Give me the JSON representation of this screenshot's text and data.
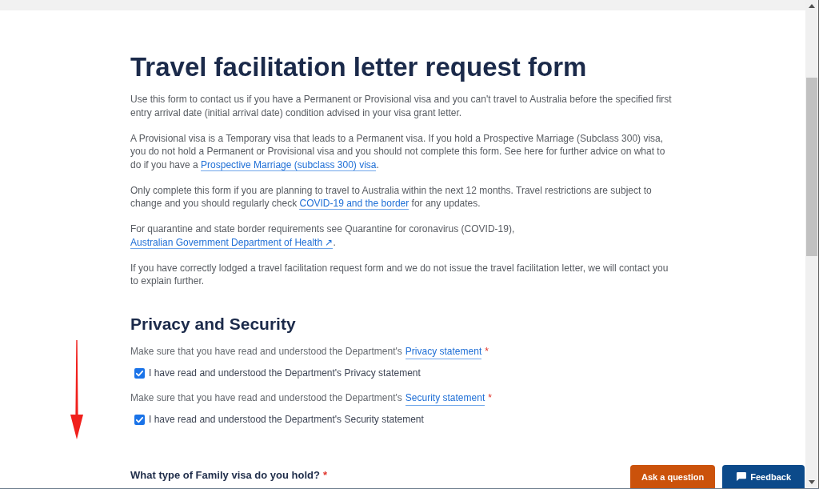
{
  "page": {
    "title": "Travel facilitation letter request form",
    "paragraphs": [
      {
        "parts": [
          {
            "kind": "text",
            "text": "Use this form to contact us if you have a Permanent or Provisional visa and you can't travel to Australia before the specified first entry arrival date (initial arrival date) condition advised in your visa grant letter."
          }
        ]
      },
      {
        "parts": [
          {
            "kind": "text",
            "text": "A Provisional visa is a Temporary visa that leads to a Permanent visa. If you hold a Prospective Marriage (Subclass 300) visa, you do not hold a Permanent or Provisional visa and you should not complete this form. See here for further advice on what to do if you have a "
          },
          {
            "kind": "link",
            "text": "Prospective Marriage (subclass 300) visa"
          },
          {
            "kind": "text",
            "text": "."
          }
        ]
      },
      {
        "parts": [
          {
            "kind": "text",
            "text": "Only complete this form if you are planning to travel to Australia within the next 12 months. Travel restrictions are subject to change and you should regularly check "
          },
          {
            "kind": "link",
            "text": "COVID-19 and the border"
          },
          {
            "kind": "text",
            "text": " for any updates."
          }
        ]
      },
      {
        "parts": [
          {
            "kind": "text",
            "text": "For quarantine and state border requirements see Quarantine for coronavirus (COVID-19), "
          },
          {
            "kind": "link",
            "text": "Australian Government Department of Health ↗"
          },
          {
            "kind": "text",
            "text": "."
          }
        ]
      },
      {
        "parts": [
          {
            "kind": "text",
            "text": "If you have correctly lodged a travel facilitation request form and we do not issue the travel facilitation letter, we will contact you to explain further."
          }
        ]
      }
    ],
    "privacy_section": {
      "heading": "Privacy and Security",
      "items": [
        {
          "prompt": "Make sure that you have read and understood the Department's",
          "link": "Privacy statement",
          "required_mark": "*",
          "checkbox": {
            "label": "I have read and understood the Department's Privacy statement",
            "checked": true
          }
        },
        {
          "prompt": "Make sure that you have read and understood the Department's",
          "link": "Security statement",
          "required_mark": "*",
          "checkbox": {
            "label": "I have read and understood the Department's Security statement",
            "checked": true
          }
        }
      ]
    },
    "question": {
      "label": "What type of Family visa do you hold?",
      "required_mark": "*"
    }
  },
  "floating_buttons": [
    {
      "kind": "ask",
      "label": "Ask a question"
    },
    {
      "kind": "feedback",
      "label": "Feedback"
    }
  ]
}
